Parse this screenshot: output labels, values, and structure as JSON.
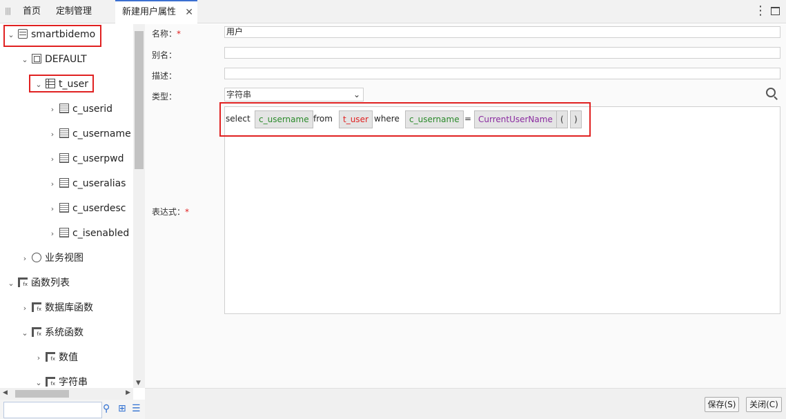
{
  "tabs": {
    "home": "首页",
    "custom": "定制管理",
    "active": "新建用户属性",
    "close": "✕"
  },
  "tree": {
    "root": "smartbidemo",
    "schema": "DEFAULT",
    "table": "t_user",
    "columns": [
      "c_userid",
      "c_username",
      "c_userpwd",
      "c_useralias",
      "c_userdesc",
      "c_isenabled"
    ],
    "business_view": "业务视图",
    "functions": "函数列表",
    "db_functions": "数据库函数",
    "sys_functions": "系统函数",
    "numeric": "数值",
    "string": "字符串"
  },
  "form": {
    "name_label": "名称：",
    "name_value": "用户",
    "alias_label": "别名：",
    "desc_label": "描述：",
    "type_label": "类型：",
    "type_value": "字符串",
    "expr_label": "表达式：",
    "required_mark": "*"
  },
  "expression": {
    "select": "select",
    "col1": "c_username",
    "from": "from",
    "table": "t_user",
    "where": "where",
    "col2": "c_username",
    "eq": "=",
    "func": "CurrentUserName",
    "lparen": "(",
    "rparen": ")"
  },
  "buttons": {
    "save": "保存(S)",
    "close": "关闭(C)"
  },
  "colors": {
    "highlight": "#e02020",
    "column_token": "#2a8a2a",
    "table_token": "#e02020",
    "function_token": "#8a2aa0",
    "active_tab": "#3b6fd0"
  }
}
